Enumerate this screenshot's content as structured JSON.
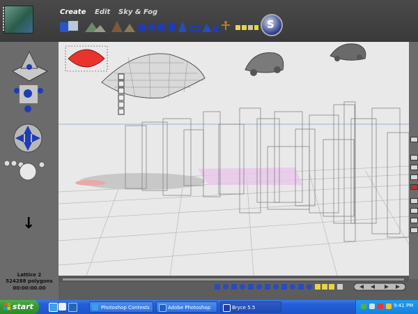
{
  "app": {
    "name": "Bryce 5.5",
    "menus": {
      "create": "Create",
      "edit": "Edit",
      "sky_fog": "Sky & Fog"
    },
    "logo_glyph": "S"
  },
  "create_toolbar": {
    "icons": [
      "terrain-icon",
      "stone-icon",
      "tree-icon",
      "sphere-icon",
      "cube-icon",
      "cylinder-icon",
      "cone-icon",
      "torus-icon",
      "pyramid-icon",
      "figure-icon",
      "material-icon"
    ]
  },
  "status": {
    "object_name": "Lattice 2",
    "polygon_count": "524288 polygons",
    "timecode": "00:00:00.00"
  },
  "taskbar": {
    "start_label": "start",
    "tasks": [
      "Photoshop Contests ...",
      "Adobe Photoshop",
      "Bryce 5.5"
    ],
    "clock": "9:41 PM"
  },
  "colors": {
    "accent_blue": "#1e3cb4",
    "selected_red": "#e8332f",
    "xp_blue": "#245edb",
    "xp_green": "#3a9a36"
  }
}
